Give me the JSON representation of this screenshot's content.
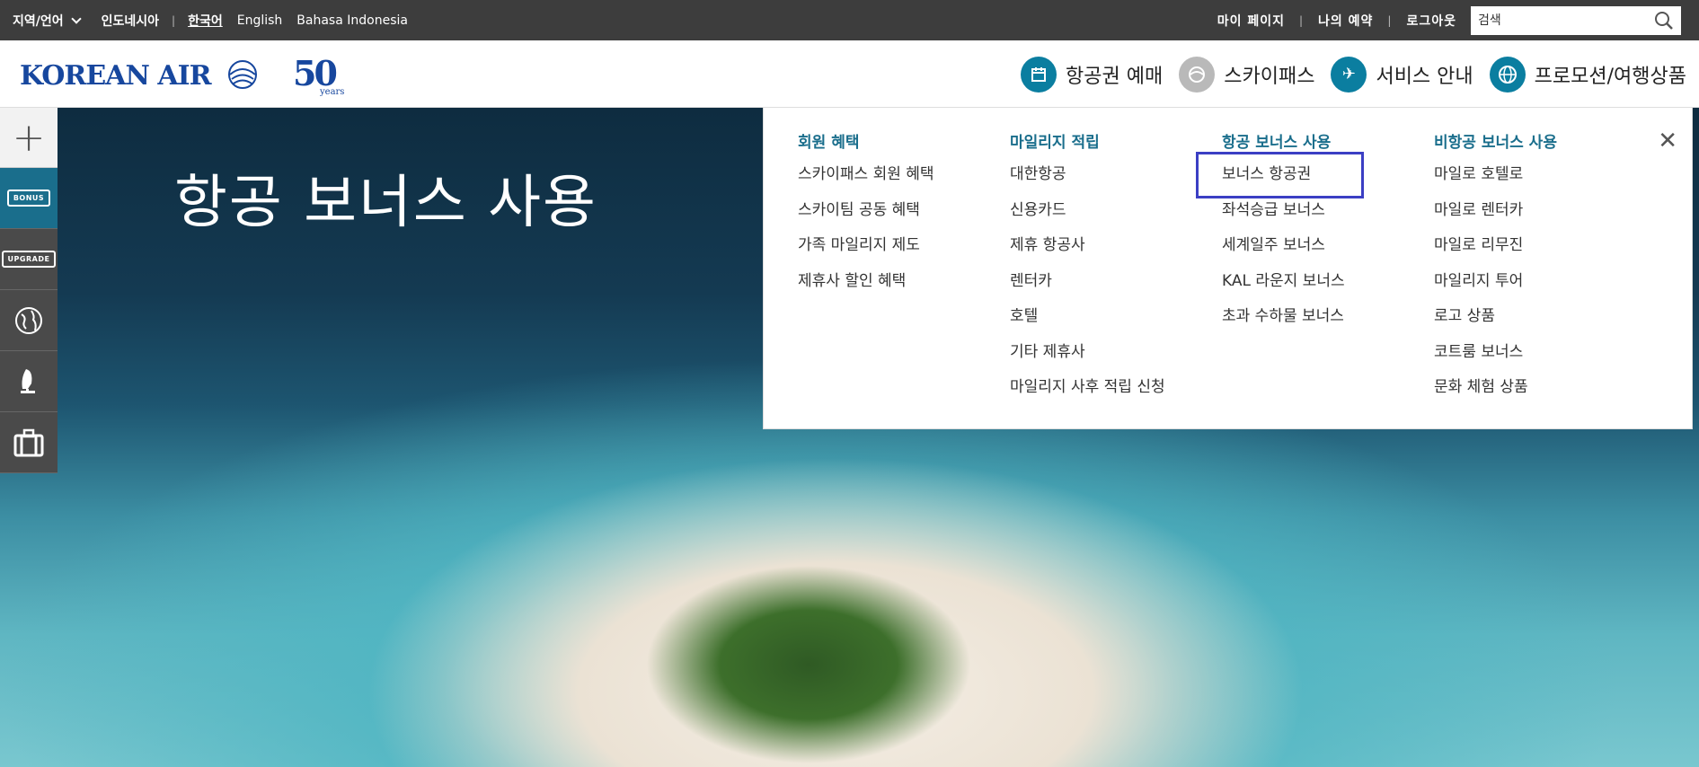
{
  "topbar": {
    "region_label": "지역/언어",
    "languages": [
      "인도네시아",
      "한국어",
      "English",
      "Bahasa Indonesia"
    ],
    "links": [
      "마이 페이지",
      "나의 예약",
      "로그아웃"
    ],
    "search_placeholder": "검색"
  },
  "header": {
    "logo_text": "KOREAN AIR",
    "anniversary_number": "50",
    "anniversary_unit": "years",
    "nav": [
      {
        "label": "항공권 예매",
        "icon": "calendar-icon"
      },
      {
        "label": "스카이패스",
        "icon": "skypass-icon"
      },
      {
        "label": "서비스 안내",
        "icon": "airplane-icon"
      },
      {
        "label": "프로모션/여행상품",
        "icon": "globe-icon"
      }
    ]
  },
  "hero": {
    "title": "항공 보너스 사용"
  },
  "sidebar": {
    "items": [
      {
        "label": "+",
        "icon": "plus-icon"
      },
      {
        "label": "BONUS",
        "icon": "bonus-ticket-icon"
      },
      {
        "label": "UPGRADE",
        "icon": "upgrade-ticket-icon"
      },
      {
        "label": "",
        "icon": "globe-icon"
      },
      {
        "label": "",
        "icon": "seat-icon"
      },
      {
        "label": "",
        "icon": "luggage-icon"
      }
    ]
  },
  "menu": {
    "columns": [
      {
        "title": "회원 혜택",
        "items": [
          "스카이패스 회원 혜택",
          "스카이팀 공동 혜택",
          "가족 마일리지 제도",
          "제휴사 할인 혜택"
        ]
      },
      {
        "title": "마일리지 적립",
        "items": [
          "대한항공",
          "신용카드",
          "제휴 항공사",
          "렌터카",
          "호텔",
          "기타 제휴사",
          "마일리지 사후 적립 신청"
        ]
      },
      {
        "title": "항공 보너스 사용",
        "items": [
          "보너스 항공권",
          "좌석승급 보너스",
          "세계일주 보너스",
          "KAL 라운지 보너스",
          "초과 수하물 보너스"
        ]
      },
      {
        "title": "비항공 보너스 사용",
        "items": [
          "마일로 호텔로",
          "마일로 렌터카",
          "마일로 리무진",
          "마일리지 투어",
          "로고 상품",
          "코트룸 보너스",
          "문화 체험 상품"
        ]
      }
    ],
    "close_symbol": "✕"
  }
}
